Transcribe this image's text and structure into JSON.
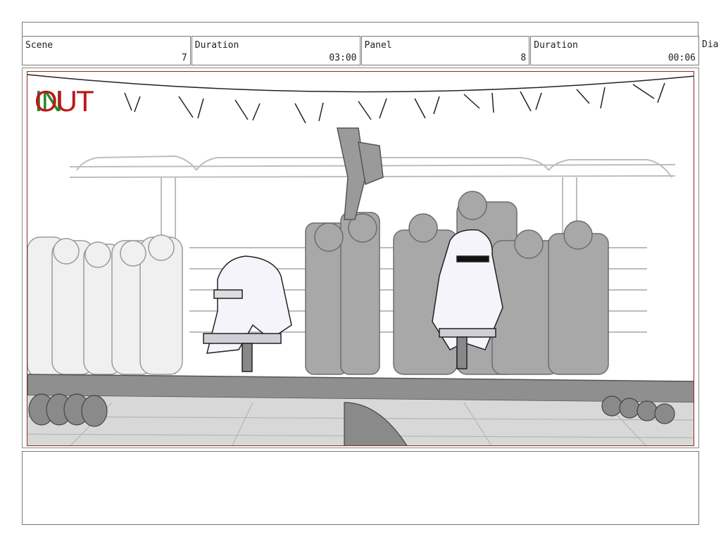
{
  "header": {
    "scene_label": "Scene",
    "scene_value": "7",
    "scene_duration_label": "Duration",
    "scene_duration_value": "03:00",
    "panel_label": "Panel",
    "panel_value": "8",
    "panel_duration_label": "Duration",
    "panel_duration_value": "00:06",
    "dialogue_label": "Dia"
  },
  "panel": {
    "in_marker": "IN",
    "out_marker": "OUT",
    "frame_color": "#8b2a1e",
    "in_color": "#1f8a2a",
    "out_color": "#c0151c"
  },
  "notes": {
    "text": ""
  }
}
